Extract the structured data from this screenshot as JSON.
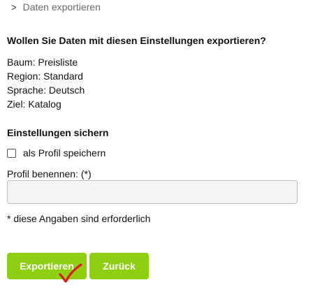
{
  "breadcrumb": {
    "icon": "chevron-right-icon",
    "label": "Daten exportieren"
  },
  "confirm": {
    "question": "Wollen Sie Daten mit diesen Einstellungen exportieren?",
    "summary": [
      "Baum: Preisliste",
      "Region: Standard",
      "Sprache: Deutsch",
      "Ziel: Katalog"
    ]
  },
  "settings": {
    "title": "Einstellungen sichern",
    "save_profile_label": "als Profil speichern",
    "save_profile_checked": false,
    "profile_name_label": "Profil benennen: (*)",
    "profile_name_value": "",
    "required_note": "* diese Angaben sind erforderlich"
  },
  "actions": {
    "export_label": "Exportieren",
    "back_label": "Zurück",
    "accent_color": "#8fcf12"
  },
  "annotation": {
    "icon": "red-checkmark-icon",
    "color": "#e0191b"
  }
}
